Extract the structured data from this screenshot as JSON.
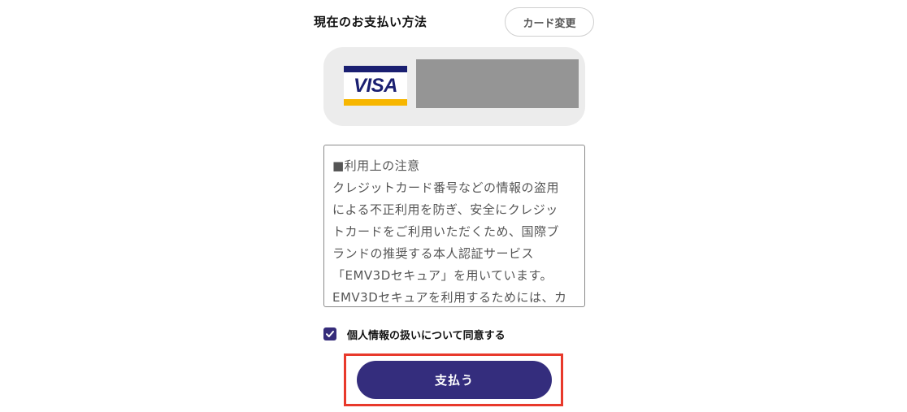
{
  "payment": {
    "title": "現在のお支払い方法",
    "change_card_label": "カード変更",
    "card_brand": "VISA"
  },
  "notice": {
    "lines": [
      "■利用上の注意",
      "クレジットカード番号などの情報の盗用",
      "による不正利用を防ぎ、安全にクレジッ",
      "トカードをご利用いただくため、国際ブ",
      "ランドの推奨する本人認証サービス",
      "「EMV3Dセキュア」を用いています。",
      "EMV3Dセキュアを利用するためには、カ"
    ]
  },
  "consent": {
    "label": "個人情報の扱いについて同意する",
    "checked": true
  },
  "pay_button_label": "支払う",
  "colors": {
    "primary": "#342d7d",
    "highlight": "#e8392b",
    "card_bg": "#ececec",
    "visa_blue": "#1a1f71",
    "visa_gold": "#f7b600"
  }
}
